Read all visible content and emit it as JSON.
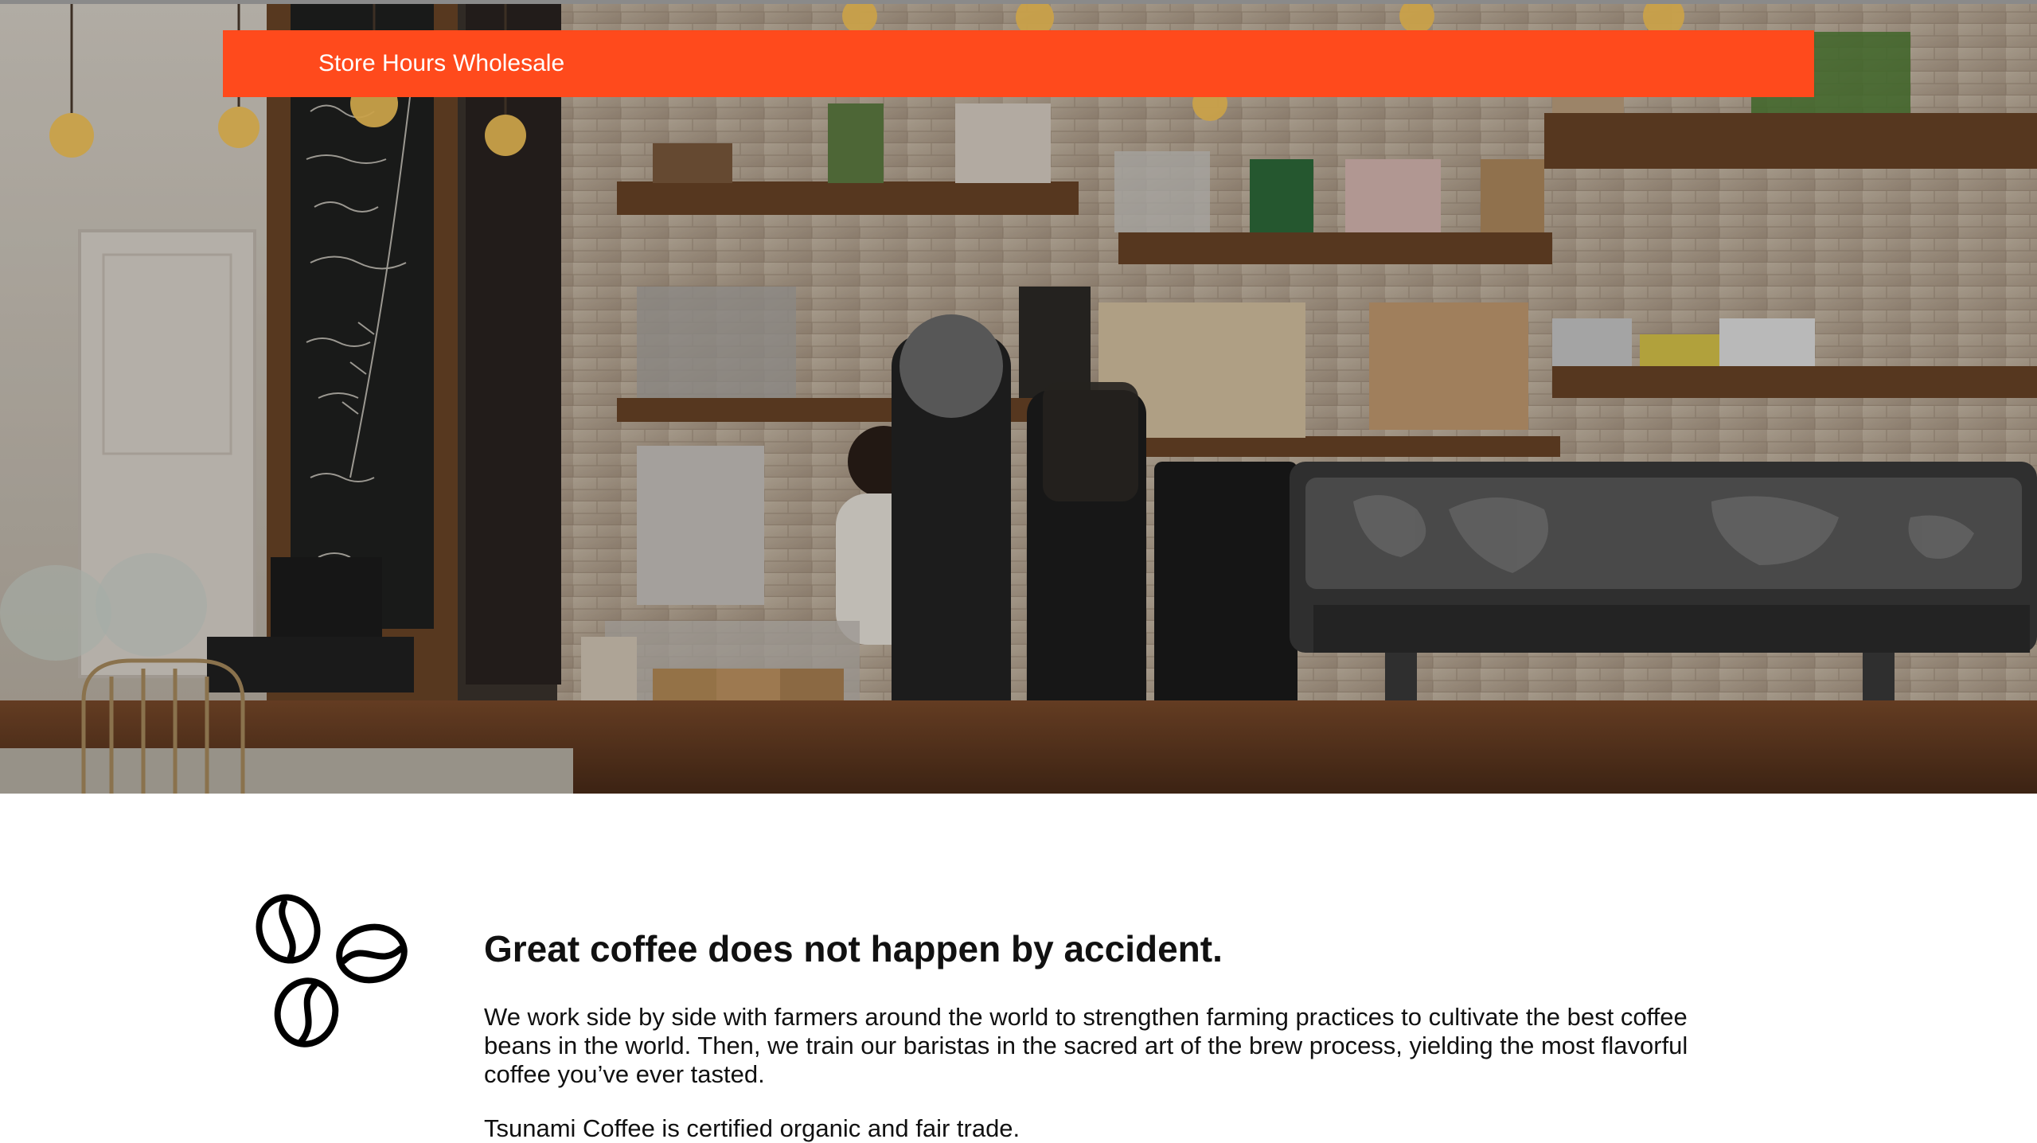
{
  "nav": {
    "links": [
      "Store Hours",
      "Wholesale"
    ]
  },
  "hero": {
    "image": "coffee-shop-counter-photo"
  },
  "content": {
    "icon": "coffee-beans-icon",
    "headline": "Great coffee does not happen by accident.",
    "paragraph1": "We work side by side with farmers around the world to strengthen farming practices to cultivate the best coffee beans in the world. Then, we train our baristas in the sacred art of the brew process, yielding the most flavorful coffee you’ve ever tasted.",
    "paragraph2": "Tsunami Coffee is certified organic and fair trade."
  },
  "colors": {
    "nav_background": "#ff4a1c",
    "nav_text": "#ffffff",
    "body_text": "#111111"
  }
}
